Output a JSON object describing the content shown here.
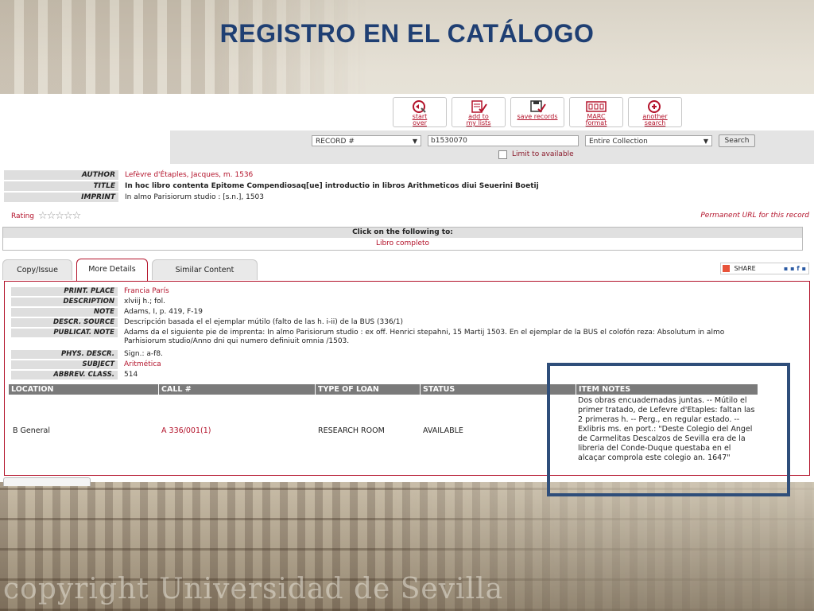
{
  "slide": {
    "title": "REGISTRO EN EL CATÁLOGO",
    "watermark": "copyright Universidad de Sevilla"
  },
  "toolbar": {
    "start_over": "start\nover",
    "add_to_lists": "add to\nmy lists",
    "save_records": "save records",
    "marc_format": "MARC\nformat",
    "another_search": "another\nsearch"
  },
  "search": {
    "field_select": "RECORD #",
    "query": "b1530070",
    "scope_select": "Entire Collection",
    "search_button": "Search",
    "limit_label": "Limit to available"
  },
  "record": {
    "author_label": "AUTHOR",
    "author": "Lefèvre d'Étaples, Jacques, m. 1536",
    "title_label": "TITLE",
    "title": "In hoc libro contenta Epitome Compendiosaq[ue] introductio in libros Arithmeticos diui Seuerini Boetij",
    "imprint_label": "IMPRINT",
    "imprint": "In almo Parisiorum studio : [s.n.], 1503"
  },
  "rating": {
    "label": "Rating",
    "stars": "☆☆☆☆☆"
  },
  "permanent_url": "Permanent URL for this record",
  "click_following": {
    "header": "Click on the following to:",
    "link": "Libro completo"
  },
  "tabs": [
    "Copy/Issue",
    "More Details",
    "Similar Content"
  ],
  "share": {
    "label": "SHARE"
  },
  "details": {
    "print_place_label": "PRINT. PLACE",
    "print_place": "Francia París",
    "description_label": "DESCRIPTION",
    "description": "xlviij h.; fol.",
    "note_label": "NOTE",
    "note": "Adams, I, p. 419, F-19",
    "descr_source_label": "DESCR. SOURCE",
    "descr_source": "Descripción basada el el ejemplar mútilo (falto de las h. i-ii) de la BUS (336/1)",
    "publicat_note_label": "PUBLICAT. NOTE",
    "publicat_note": "Adams da el siguiente pie de imprenta: In almo Parisiorum studio : ex off. Henrici stepahni, 15 Martij 1503. En el ejemplar de la BUS el colofón reza: Absolutum in almo Parhisiorum studio/Anno dni qui numero definiuit omnia /1503.",
    "phys_descr_label": "PHYS. DESCR.",
    "phys_descr": "Sign.: a-f8.",
    "subject_label": "SUBJECT",
    "subject": "Aritmética",
    "abbrev_class_label": "ABBREV. CLASS.",
    "abbrev_class": "514"
  },
  "items": {
    "headers": [
      "LOCATION",
      "CALL #",
      "TYPE OF LOAN",
      "STATUS",
      "ITEM NOTES"
    ],
    "row": {
      "location": "B General",
      "call": "A 336/001(1)",
      "type": "RESEARCH ROOM",
      "status": "AVAILABLE",
      "notes": " Dos obras encuadernadas juntas. -- Mútilo el primer tratado, de Lefevre d'Etaples: faltan las 2 primeras h. -- Perg., en regular estado. -- Exlibris ms. en port.: \"Deste Colegio del Angel de Carmelitas Descalzos de Sevilla era de la libreria del Conde-Duque questaba en el alcaçar comprola este colegio an. 1647\""
    }
  },
  "colors": {
    "accent": "#b3122a",
    "title": "#1f3f73",
    "highlight": "#2f4e7a"
  }
}
